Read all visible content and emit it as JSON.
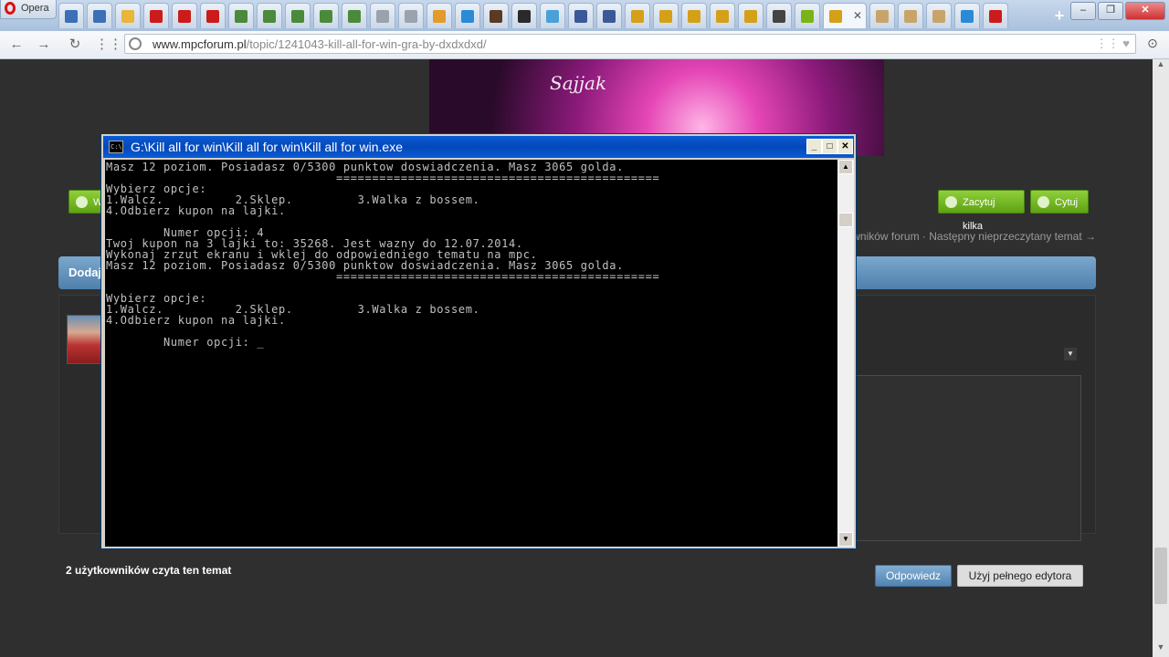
{
  "browser": {
    "menu_label": "Opera",
    "tab_favicons": [
      {
        "icon": "a-icon",
        "color": "#3b6fb6"
      },
      {
        "icon": "a-icon",
        "color": "#3b6fb6"
      },
      {
        "icon": "chrome-icon",
        "color": "#e9b53b"
      },
      {
        "icon": "youtube-icon",
        "color": "#cc1b1b"
      },
      {
        "icon": "youtube-icon",
        "color": "#cc1b1b"
      },
      {
        "icon": "youtube-icon",
        "color": "#cc1b1b"
      },
      {
        "icon": "skull-icon",
        "color": "#4a8a3a"
      },
      {
        "icon": "skull-icon",
        "color": "#4a8a3a"
      },
      {
        "icon": "skull-icon",
        "color": "#4a8a3a"
      },
      {
        "icon": "skull-icon",
        "color": "#4a8a3a"
      },
      {
        "icon": "skull-icon",
        "color": "#4a8a3a"
      },
      {
        "icon": "page-icon",
        "color": "#9aa3ad"
      },
      {
        "icon": "page-icon",
        "color": "#9aa3ad"
      },
      {
        "icon": "chat-icon",
        "color": "#e39b2b"
      },
      {
        "icon": "c-icon",
        "color": "#2b8ad6"
      },
      {
        "icon": "burger-icon",
        "color": "#5a3a22"
      },
      {
        "icon": "x-icon",
        "color": "#2a2a2a"
      },
      {
        "icon": "v-icon",
        "color": "#4aa0d8"
      },
      {
        "icon": "facebook-icon",
        "color": "#3b5998"
      },
      {
        "icon": "facebook-icon",
        "color": "#3b5998"
      },
      {
        "icon": "clapper-icon",
        "color": "#d4a017"
      },
      {
        "icon": "clapper-icon",
        "color": "#d4a017"
      },
      {
        "icon": "clapper-icon",
        "color": "#d4a017"
      },
      {
        "icon": "clapper-icon",
        "color": "#d4a017"
      },
      {
        "icon": "clapper-icon",
        "color": "#d4a017"
      },
      {
        "icon": "n-icon",
        "color": "#444"
      },
      {
        "icon": "fp-icon",
        "color": "#7ab317"
      }
    ],
    "active_tab_favicon": {
      "icon": "clapper-icon",
      "color": "#d4a017"
    },
    "trailing_tab_favicons": [
      {
        "icon": "pencil-icon",
        "color": "#c9a46a"
      },
      {
        "icon": "pencil-icon",
        "color": "#c9a46a"
      },
      {
        "icon": "pencil-icon",
        "color": "#c9a46a"
      },
      {
        "icon": "b-icon",
        "color": "#2b8ad6"
      },
      {
        "icon": "youtube-icon",
        "color": "#cc1b1b"
      }
    ],
    "address": {
      "host": "www.mpcforum.pl",
      "path": "/topic/1241043-kill-all-for-win-gra-by-dxdxdxd/"
    }
  },
  "page": {
    "banner_signature": "Sajjak",
    "button_left_label": "W",
    "multiquote_label": "Zacytuj kilka",
    "quote_label": "Cytuj",
    "nav_links": "ytkowników forum · Następny nieprzeczytany temat →",
    "reply_bar_title": "Dodaj",
    "submit_label": "Odpowiedz",
    "full_editor_label": "Użyj pełnego edytora",
    "readers_label": "2 użytkowników czyta ten temat",
    "accent_color": "#5284b2",
    "green_button_color": "#6cb21f"
  },
  "console": {
    "title": "G:\\Kill all for win\\Kill all for win\\Kill all for win.exe",
    "lines": [
      "Masz 12 poziom. Posiadasz 0/5300 punktow doswiadczenia. Masz 3065 golda.",
      "                                =============================================",
      "Wybierz opcje:",
      "1.Walcz.          2.Sklep.         3.Walka z bossem.",
      "4.Odbierz kupon na lajki.",
      "",
      "        Numer opcji: 4",
      "Twoj kupon na 3 lajki to: 35268. Jest wazny do 12.07.2014.",
      "Wykonaj zrzut ekranu i wklej do odpowiedniego tematu na mpc.",
      "Masz 12 poziom. Posiadasz 0/5300 punktow doswiadczenia. Masz 3065 golda.",
      "                                =============================================",
      "",
      "Wybierz opcje:",
      "1.Walcz.          2.Sklep.         3.Walka z bossem.",
      "4.Odbierz kupon na lajki.",
      "",
      "        Numer opcji: _"
    ]
  }
}
